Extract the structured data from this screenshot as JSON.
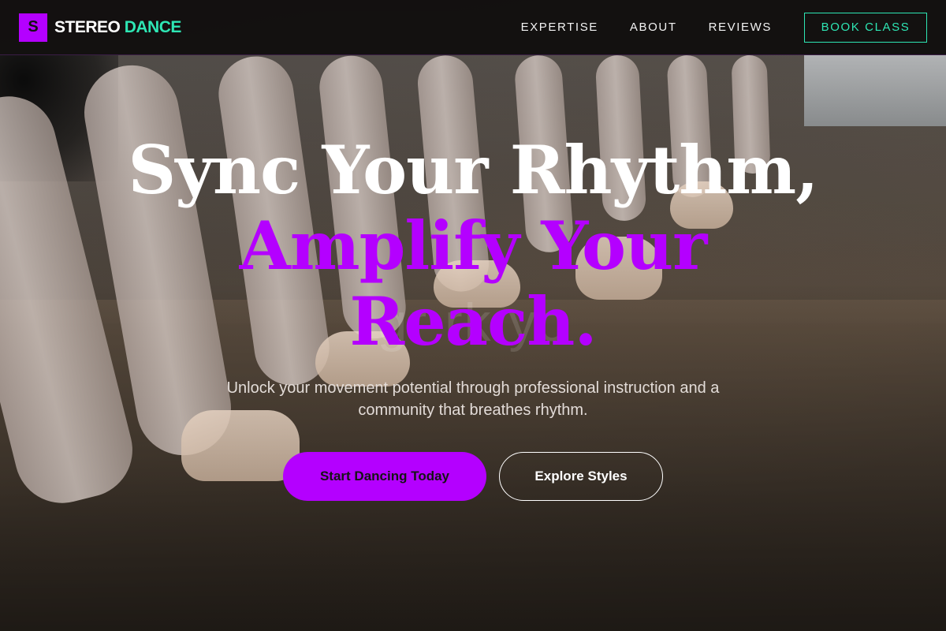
{
  "brand": {
    "mark": "S",
    "word1": "STEREO",
    "word2": "DANCE",
    "accent_purple": "#b400ff",
    "accent_teal": "#2ee6b4"
  },
  "nav": {
    "links": [
      {
        "label": "EXPERTISE"
      },
      {
        "label": "ABOUT"
      },
      {
        "label": "REVIEWS"
      }
    ],
    "cta": "BOOK CLASS"
  },
  "hero": {
    "line1": "Sync Your Rhythm,",
    "line2": "Amplify Your",
    "line3": "Reach.",
    "watermark": "gr      rk yo",
    "subtitle": "Unlock your movement potential through professional instruction and a community that breathes rhythm.",
    "primary_button": "Start Dancing Today",
    "secondary_button": "Explore Styles",
    "background_image": "ballet-dancers-feet-at-barre"
  }
}
